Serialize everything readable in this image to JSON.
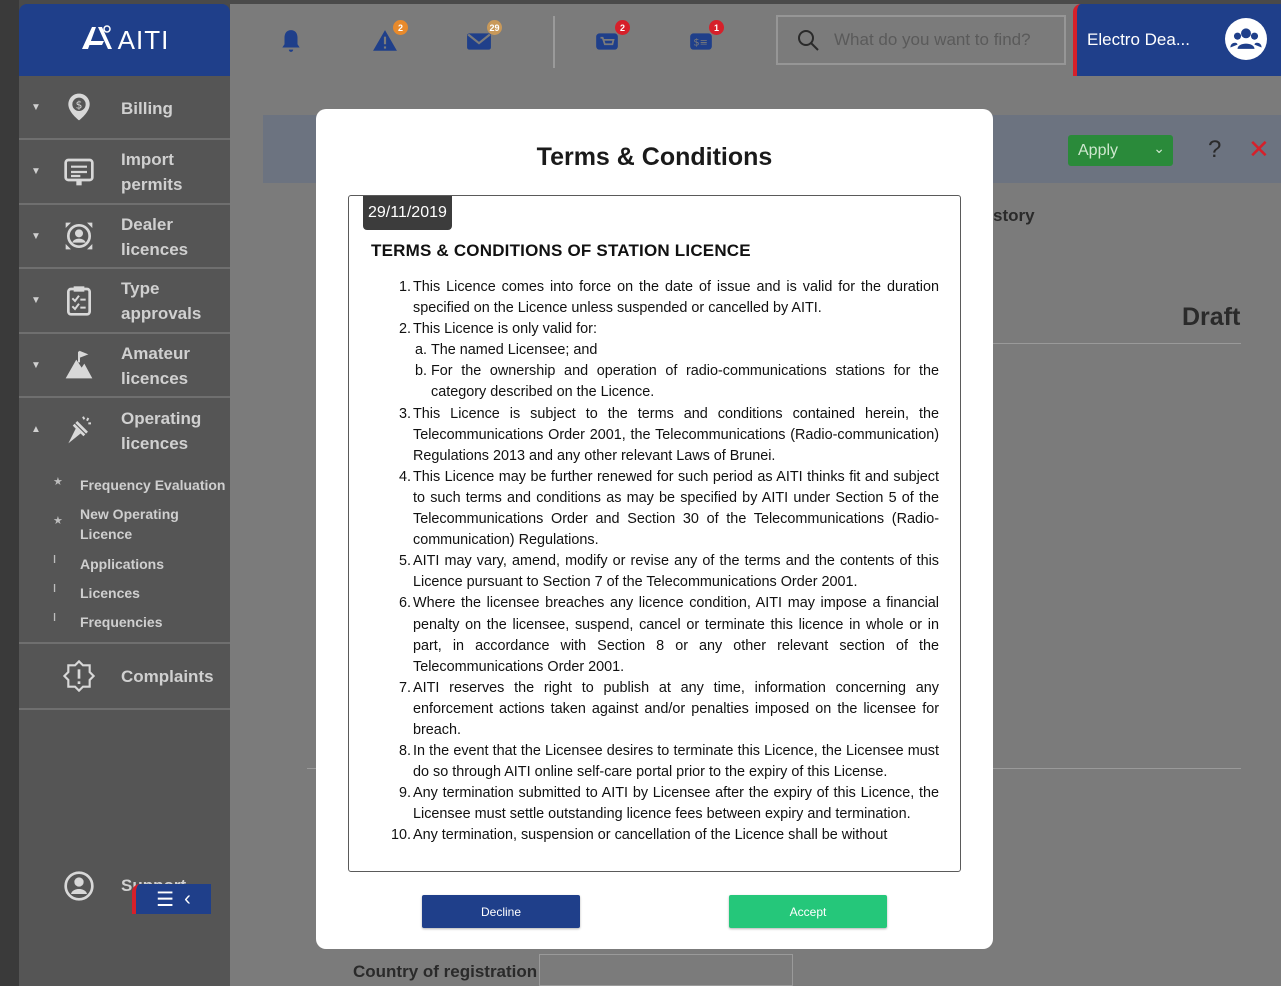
{
  "app": {
    "logo_text": "AITI"
  },
  "header": {
    "icons": [
      {
        "name": "bell-icon",
        "badge": ""
      },
      {
        "name": "alert-icon",
        "badge": "2"
      },
      {
        "name": "mail-icon",
        "badge": "29"
      },
      {
        "name": "cart-icon",
        "badge": "2"
      },
      {
        "name": "invoice-icon",
        "badge": "1"
      }
    ],
    "search_placeholder": "What do you want to find?",
    "user_name": "Electro Dea..."
  },
  "sidebar": {
    "items": [
      {
        "label_line1": "Billing",
        "label_line2": ""
      },
      {
        "label_line1": "Import",
        "label_line2": "permits"
      },
      {
        "label_line1": "Dealer",
        "label_line2": "licences"
      },
      {
        "label_line1": "Type",
        "label_line2": "approvals"
      },
      {
        "label_line1": "Amateur",
        "label_line2": "licences"
      },
      {
        "label_line1": "Operating",
        "label_line2": "licences"
      }
    ],
    "subitems": [
      {
        "label": "Frequency Evaluation"
      },
      {
        "label_line1": "New Operating",
        "label_line2": "Licence"
      },
      {
        "label": "Applications"
      },
      {
        "label": "Licences"
      },
      {
        "label": "Frequencies"
      }
    ],
    "complaints": "Complaints",
    "support": "Support"
  },
  "background": {
    "apply_label": "Apply",
    "history_fragment": "story",
    "status": "Draft",
    "country_label": "Country of registration"
  },
  "modal": {
    "title": "Terms & Conditions",
    "date": "29/11/2019",
    "heading": "TERMS & CONDITIONS OF STATION LICENCE",
    "clauses": [
      "This Licence comes into force on the date of issue and is valid for the duration specified on the Licence unless suspended or cancelled by AITI.",
      "This Licence is only valid for:",
      "This Licence is subject to the terms and conditions contained herein, the Telecommunications Order 2001, the Telecommunications (Radio-communication) Regulations 2013 and any other relevant Laws of Brunei.",
      "This Licence may be further renewed for such period as AITI thinks fit and subject to such terms and conditions as may be specified by AITI under Section 5 of the Telecommunications Order and Section 30 of the Telecommunications (Radio-communication) Regulations.",
      "AITI may vary, amend, modify or revise any of the terms and the contents of this Licence pursuant to Section 7 of the Telecommunications Order 2001.",
      "Where the licensee breaches any licence condition, AITI may impose a financial penalty on the licensee, suspend, cancel or terminate this licence in whole or in part, in accordance with Section 8 or any other relevant section of the Telecommunications Order 2001.",
      "AITI reserves the right to publish at any time, information concerning any enforcement actions taken against and/or penalties imposed on the licensee for breach.",
      "In the event that the Licensee desires to terminate this Licence, the Licensee must do so through AITI online self-care portal prior to the expiry of this License.",
      "Any termination submitted to AITI by Licensee after the expiry of this Licence, the Licensee must settle outstanding licence fees between expiry and termination.",
      "Any termination, suspension or cancellation of the Licence shall be without"
    ],
    "subclauses": [
      "The named Licensee; and",
      "For the ownership and operation of radio-communications stations for the category described on the Licence."
    ],
    "decline_label": "Decline",
    "accept_label": "Accept"
  }
}
